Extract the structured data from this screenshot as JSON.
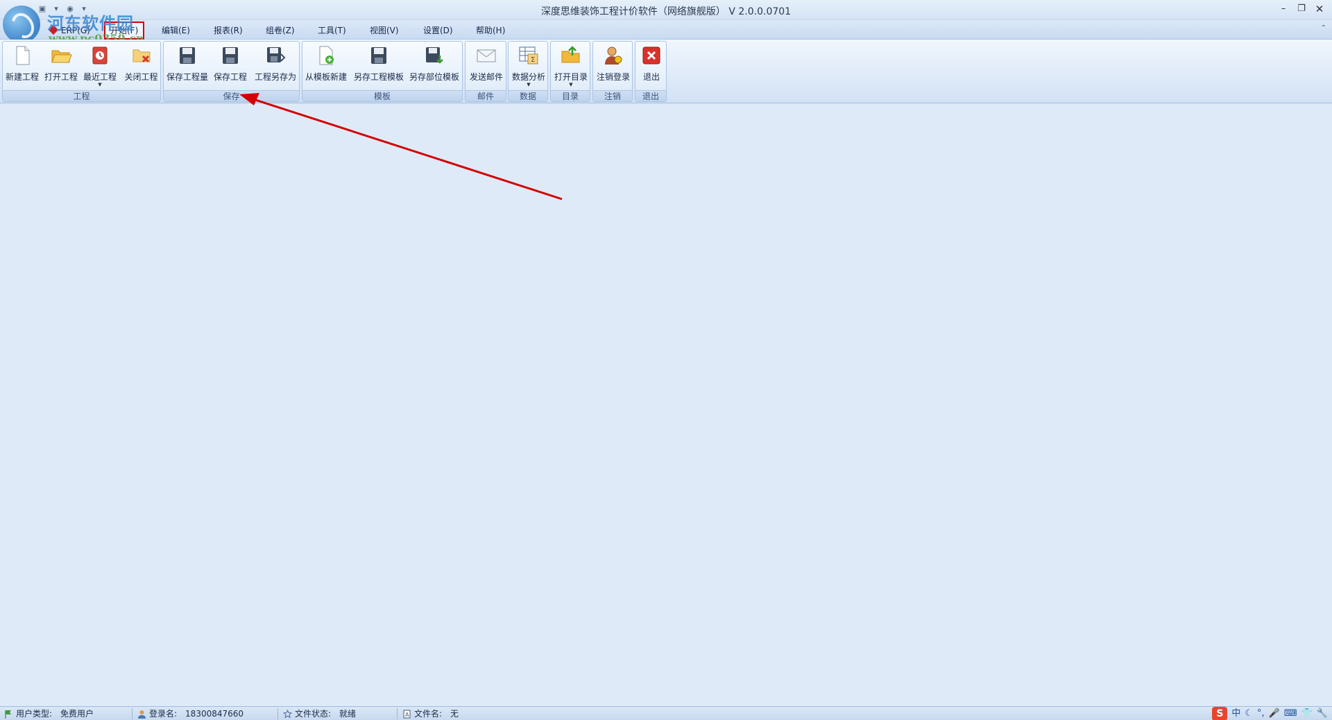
{
  "window": {
    "title": "深度思维装饰工程计价软件（网络旗舰版） V 2.0.0.0701",
    "minimize": "–",
    "restore": "❐",
    "close": "✕"
  },
  "watermark": {
    "name": "河东软件园",
    "url": "www.pc0359.cn"
  },
  "menu": {
    "items": [
      {
        "label": "ERP(G)",
        "icon": "erp-icon"
      },
      {
        "label": "开始(F)",
        "active": true
      },
      {
        "label": "编辑(E)"
      },
      {
        "label": "报表(R)"
      },
      {
        "label": "组卷(Z)"
      },
      {
        "label": "工具(T)"
      },
      {
        "label": "视图(V)"
      },
      {
        "label": "设置(D)"
      },
      {
        "label": "帮助(H)"
      }
    ],
    "collapse": "⌃"
  },
  "ribbon": {
    "groups": [
      {
        "label": "工程",
        "buttons": [
          {
            "label": "新建工程",
            "icon": "new-document-icon"
          },
          {
            "label": "打开工程",
            "icon": "open-folder-icon"
          },
          {
            "label": "最近工程",
            "icon": "recent-icon",
            "dropdown": true
          },
          {
            "label": "关闭工程",
            "icon": "close-project-icon"
          }
        ]
      },
      {
        "label": "保存",
        "buttons": [
          {
            "label": "保存工程量",
            "icon": "save-quantity-icon"
          },
          {
            "label": "保存工程",
            "icon": "save-icon"
          },
          {
            "label": "工程另存为",
            "icon": "save-as-icon"
          }
        ]
      },
      {
        "label": "模板",
        "buttons": [
          {
            "label": "从模板新建",
            "icon": "new-from-template-icon"
          },
          {
            "label": "另存工程模板",
            "icon": "save-project-template-icon"
          },
          {
            "label": "另存部位模板",
            "icon": "save-part-template-icon"
          }
        ]
      },
      {
        "label": "邮件",
        "buttons": [
          {
            "label": "发送邮件",
            "icon": "mail-icon"
          }
        ]
      },
      {
        "label": "数据",
        "buttons": [
          {
            "label": "数据分析",
            "icon": "data-analysis-icon",
            "dropdown": true
          }
        ]
      },
      {
        "label": "目录",
        "buttons": [
          {
            "label": "打开目录",
            "icon": "open-directory-icon",
            "dropdown": true
          }
        ]
      },
      {
        "label": "注销",
        "buttons": [
          {
            "label": "注销登录",
            "icon": "logout-user-icon"
          }
        ]
      },
      {
        "label": "退出",
        "buttons": [
          {
            "label": "退出",
            "icon": "exit-icon"
          }
        ]
      }
    ]
  },
  "status": {
    "user_type_label": "用户类型:",
    "user_type_value": "免费用户",
    "login_label": "登录名:",
    "login_value": "18300847660",
    "file_status_label": "文件状态:",
    "file_status_value": "就绪",
    "file_name_label": "文件名:",
    "file_name_value": "无"
  },
  "tray": {
    "ime": "S",
    "lang": "中",
    "items": [
      "☾",
      "°,",
      "🎤",
      "⌨",
      "👕",
      "🔧"
    ]
  },
  "colors": {
    "annotation": "#d40000",
    "background": "#dfeaf8"
  }
}
